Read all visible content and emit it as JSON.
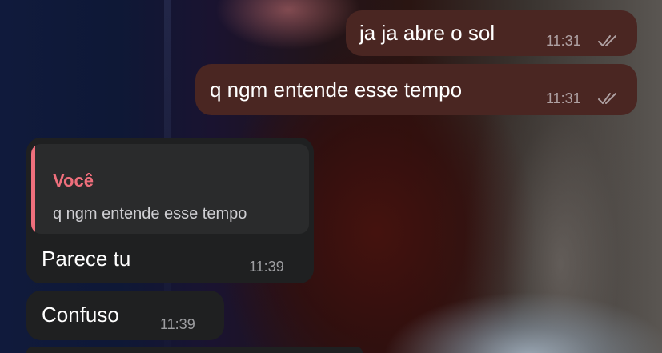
{
  "chat": {
    "messages": [
      {
        "direction": "outgoing",
        "text": "ja ja abre o sol",
        "time": "11:31",
        "status": "read"
      },
      {
        "direction": "outgoing",
        "text": "q ngm entende esse tempo",
        "time": "11:31",
        "status": "read"
      },
      {
        "direction": "incoming",
        "reply": {
          "author": "Você",
          "text": "q ngm entende esse tempo"
        },
        "text": "Parece tu",
        "time": "11:39"
      },
      {
        "direction": "incoming",
        "text": "Confuso",
        "time": "11:39"
      }
    ]
  },
  "colors": {
    "outgoing_bubble": "#4a2622",
    "incoming_bubble": "#1f2021",
    "reply_accent": "#ef6f7c"
  },
  "icons": {
    "read_status": "double-check-icon"
  }
}
